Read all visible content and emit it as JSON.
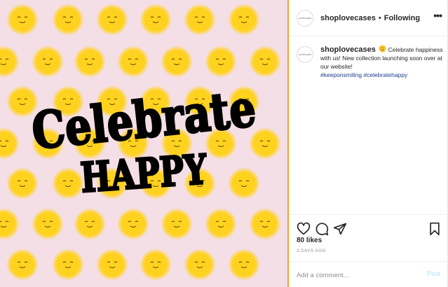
{
  "post": {
    "image_text_line1": "Celebrate",
    "image_text_line2": "HAPPY",
    "background_color": "#f5dfe6",
    "smiley_color": "#ffd21f"
  },
  "header": {
    "avatar_text": "LOVECASES",
    "username": "shoplovecases",
    "separator": "•",
    "follow_status": "Following",
    "more_icon": "more-options-icon"
  },
  "caption": {
    "avatar_text": "LOVECASES",
    "username": "shoplovecases",
    "text": " Celebrate happiness with us! New collection launching soon over at our website!",
    "hashtag1": "#keeponsmiling",
    "hashtag2": "#celebratehappy"
  },
  "actions": {
    "icons": [
      "heart-icon",
      "comment-icon",
      "share-icon",
      "bookmark-icon"
    ],
    "likes": "80 likes",
    "time_ago": "3 DAYS AGO"
  },
  "comment": {
    "placeholder": "Add a comment...",
    "post_label": "Post"
  }
}
